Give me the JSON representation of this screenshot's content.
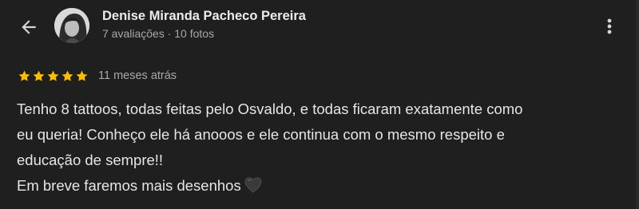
{
  "header": {
    "back_icon": "arrow-left-icon",
    "author_name": "Denise Miranda Pacheco Pereira",
    "author_meta": "7 avaliações · 10 fotos",
    "more_icon": "more-vertical-icon"
  },
  "review": {
    "rating": 5,
    "rating_max": 5,
    "star_color": "#fbbc04",
    "date": "11 meses atrás",
    "lines": [
      "Tenho 8 tattoos, todas feitas pelo Osvaldo, e todas ficaram exatamente como",
      "eu queria! Conheço ele há anooos e ele continua com o mesmo respeito e",
      "educação de sempre!!",
      "Em breve faremos mais desenhos"
    ],
    "emoji_icon": "black-heart-icon"
  },
  "colors": {
    "background": "#1f1f1f",
    "primary_text": "#e6e6e6",
    "secondary_text": "#a8a8a8"
  }
}
